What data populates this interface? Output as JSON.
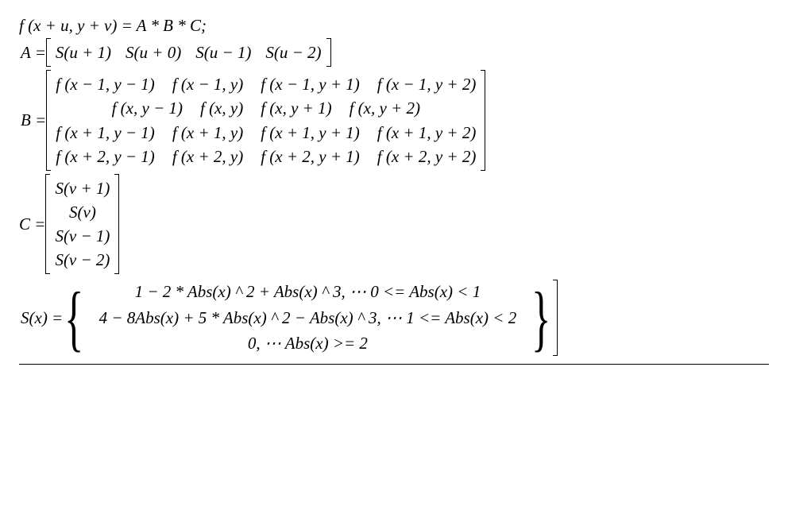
{
  "eq1": "f (x + u, y + v) = A * B * C;",
  "eqA_lhs": "A =",
  "A": [
    "S(u + 1)",
    "S(u + 0)",
    "S(u − 1)",
    "S(u − 2)"
  ],
  "eqB_lhs": "B =",
  "B": [
    [
      "f (x − 1, y − 1)",
      "f (x − 1, y)",
      "f (x − 1, y + 1)",
      "f (x − 1, y + 2)"
    ],
    [
      "f (x, y − 1)",
      "f (x, y)",
      "f (x, y + 1)",
      "f (x, y + 2)"
    ],
    [
      "f (x + 1, y − 1)",
      "f (x + 1, y)",
      "f (x + 1, y + 1)",
      "f (x + 1, y + 2)"
    ],
    [
      "f (x + 2, y − 1)",
      "f (x + 2, y)",
      "f (x + 2, y + 1)",
      "f (x + 2, y + 2)"
    ]
  ],
  "eqC_lhs": "C =",
  "C": [
    "S(v + 1)",
    "S(v)",
    "S(v − 1)",
    "S(v − 2)"
  ],
  "eqS_lhs": "S(x) =",
  "S": [
    "1 − 2 * Abs(x) ^ 2 + Abs(x) ^ 3, ⋯ 0 <= Abs(x) < 1",
    "4 − 8Abs(x) + 5 * Abs(x) ^ 2 − Abs(x) ^ 3, ⋯ 1 <= Abs(x) < 2",
    "0, ⋯ Abs(x) >= 2"
  ]
}
